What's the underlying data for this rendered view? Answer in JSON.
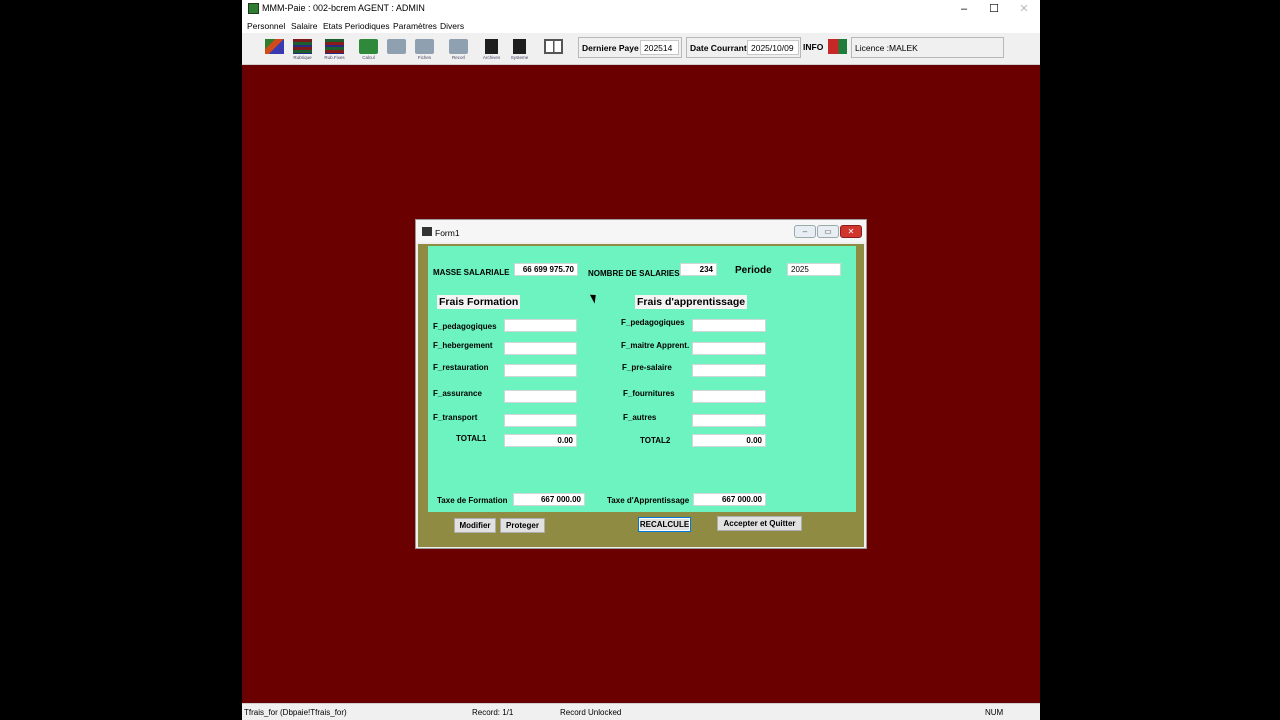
{
  "window": {
    "title": "MMM-Paie : 002-bcrem AGENT : ADMIN"
  },
  "menu": [
    "Personnel",
    "Salaire",
    "Etats Periodiques",
    "Paramètres",
    "Divers"
  ],
  "toolbar": {
    "captions": [
      "",
      "Rubrique",
      "Rub.Fixes",
      "Calcul",
      "",
      "Fiches",
      "Recorl",
      "Archives",
      "Systeme",
      ""
    ],
    "derniere_paye_label": "Derniere Paye",
    "derniere_paye_value": "202514",
    "date_courante_label": "Date Courrante",
    "date_courante_value": "2025/10/09",
    "info_label": "INFO",
    "licence": "Licence :MALEK"
  },
  "statusbar": {
    "table": "Tfrais_for (Dbpaie!Tfrais_for)",
    "record": "Record: 1/1",
    "lock": "Record Unlocked",
    "num": "NUM"
  },
  "form": {
    "title": "Form1",
    "masse_label": "MASSE SALARIALE",
    "masse_value": "66 699 975.70",
    "nb_label": "NOMBRE DE SALARIES",
    "nb_value": "234",
    "periode_label": "Periode",
    "periode_value": "2025",
    "formation": {
      "title": "Frais Formation",
      "fields": [
        {
          "label": "F_pedagogiques",
          "value": ""
        },
        {
          "label": "F_hebergement",
          "value": ""
        },
        {
          "label": "F_restauration",
          "value": ""
        },
        {
          "label": "F_assurance",
          "value": ""
        },
        {
          "label": "F_transport",
          "value": ""
        }
      ],
      "total_label": "TOTAL1",
      "total_value": "0.00"
    },
    "apprentissage": {
      "title": "Frais d'apprentissage",
      "fields": [
        {
          "label": "F_pedagogiques",
          "value": ""
        },
        {
          "label": "F_maitre Apprent.",
          "value": ""
        },
        {
          "label": "F_pre-salaire",
          "value": ""
        },
        {
          "label": "F_fournitures",
          "value": ""
        },
        {
          "label": "F_autres",
          "value": ""
        }
      ],
      "total_label": "TOTAL2",
      "total_value": "0.00"
    },
    "taxe_formation_label": "Taxe de Formation",
    "taxe_formation_value": "667 000.00",
    "taxe_apprentissage_label": "Taxe d'Apprentissage",
    "taxe_apprentissage_value": "667 000.00",
    "buttons": {
      "modifier": "Modifier",
      "proteger": "Proteger",
      "recalcule": "RECALCULE",
      "accepter": "Accepter et Quitter"
    }
  }
}
